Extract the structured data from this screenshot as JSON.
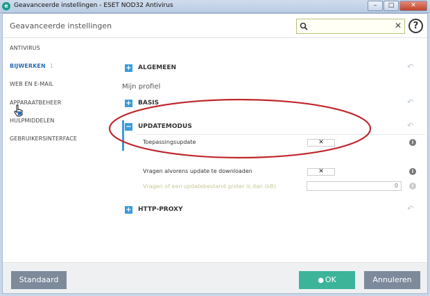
{
  "window": {
    "title": "Geavanceerde instellingen - ESET NOD32 Antivirus",
    "app_icon": "e",
    "minimize": "–",
    "maximize": "□",
    "close": "✕"
  },
  "header": {
    "title": "Geavanceerde instellingen",
    "search_value": "",
    "clear_glyph": "✕",
    "help_glyph": "?"
  },
  "sidebar": {
    "items": [
      {
        "label": "ANTIVIRUS"
      },
      {
        "label": "BIJWERKEN",
        "count": "1",
        "active": true
      },
      {
        "label": "WEB EN E-MAIL"
      },
      {
        "label": "APPARAATBEHEER"
      },
      {
        "label": "HULPMIDDELEN"
      },
      {
        "label": "GEBRUIKERSINTERFACE"
      }
    ]
  },
  "main": {
    "profile_label": "Mijn profiel",
    "sections": [
      {
        "label": "ALGEMEEN",
        "expanded": false
      },
      {
        "label": "BASIS",
        "expanded": false
      },
      {
        "label": "UPDATEMODUS",
        "expanded": true
      },
      {
        "label": "HTTP-PROXY",
        "expanded": false
      }
    ],
    "rows": [
      {
        "label": "Toepassingsupdate",
        "value": "✕"
      },
      {
        "label": "Vragen alvorens update te downloaden",
        "value": "✕"
      },
      {
        "label": "Vragen of een updatebestand groter is dan (kB)",
        "value": "0"
      }
    ],
    "info_glyph": "i",
    "revert_glyph": "↶",
    "plus_glyph": "+",
    "minus_glyph": "−"
  },
  "footer": {
    "standard_label": "Standaard",
    "ok_label": "OK",
    "cancel_label": "Annuleren"
  },
  "colors": {
    "accent": "#3a9bdc",
    "ok": "#3bb49a",
    "annotation": "#c0262c"
  }
}
